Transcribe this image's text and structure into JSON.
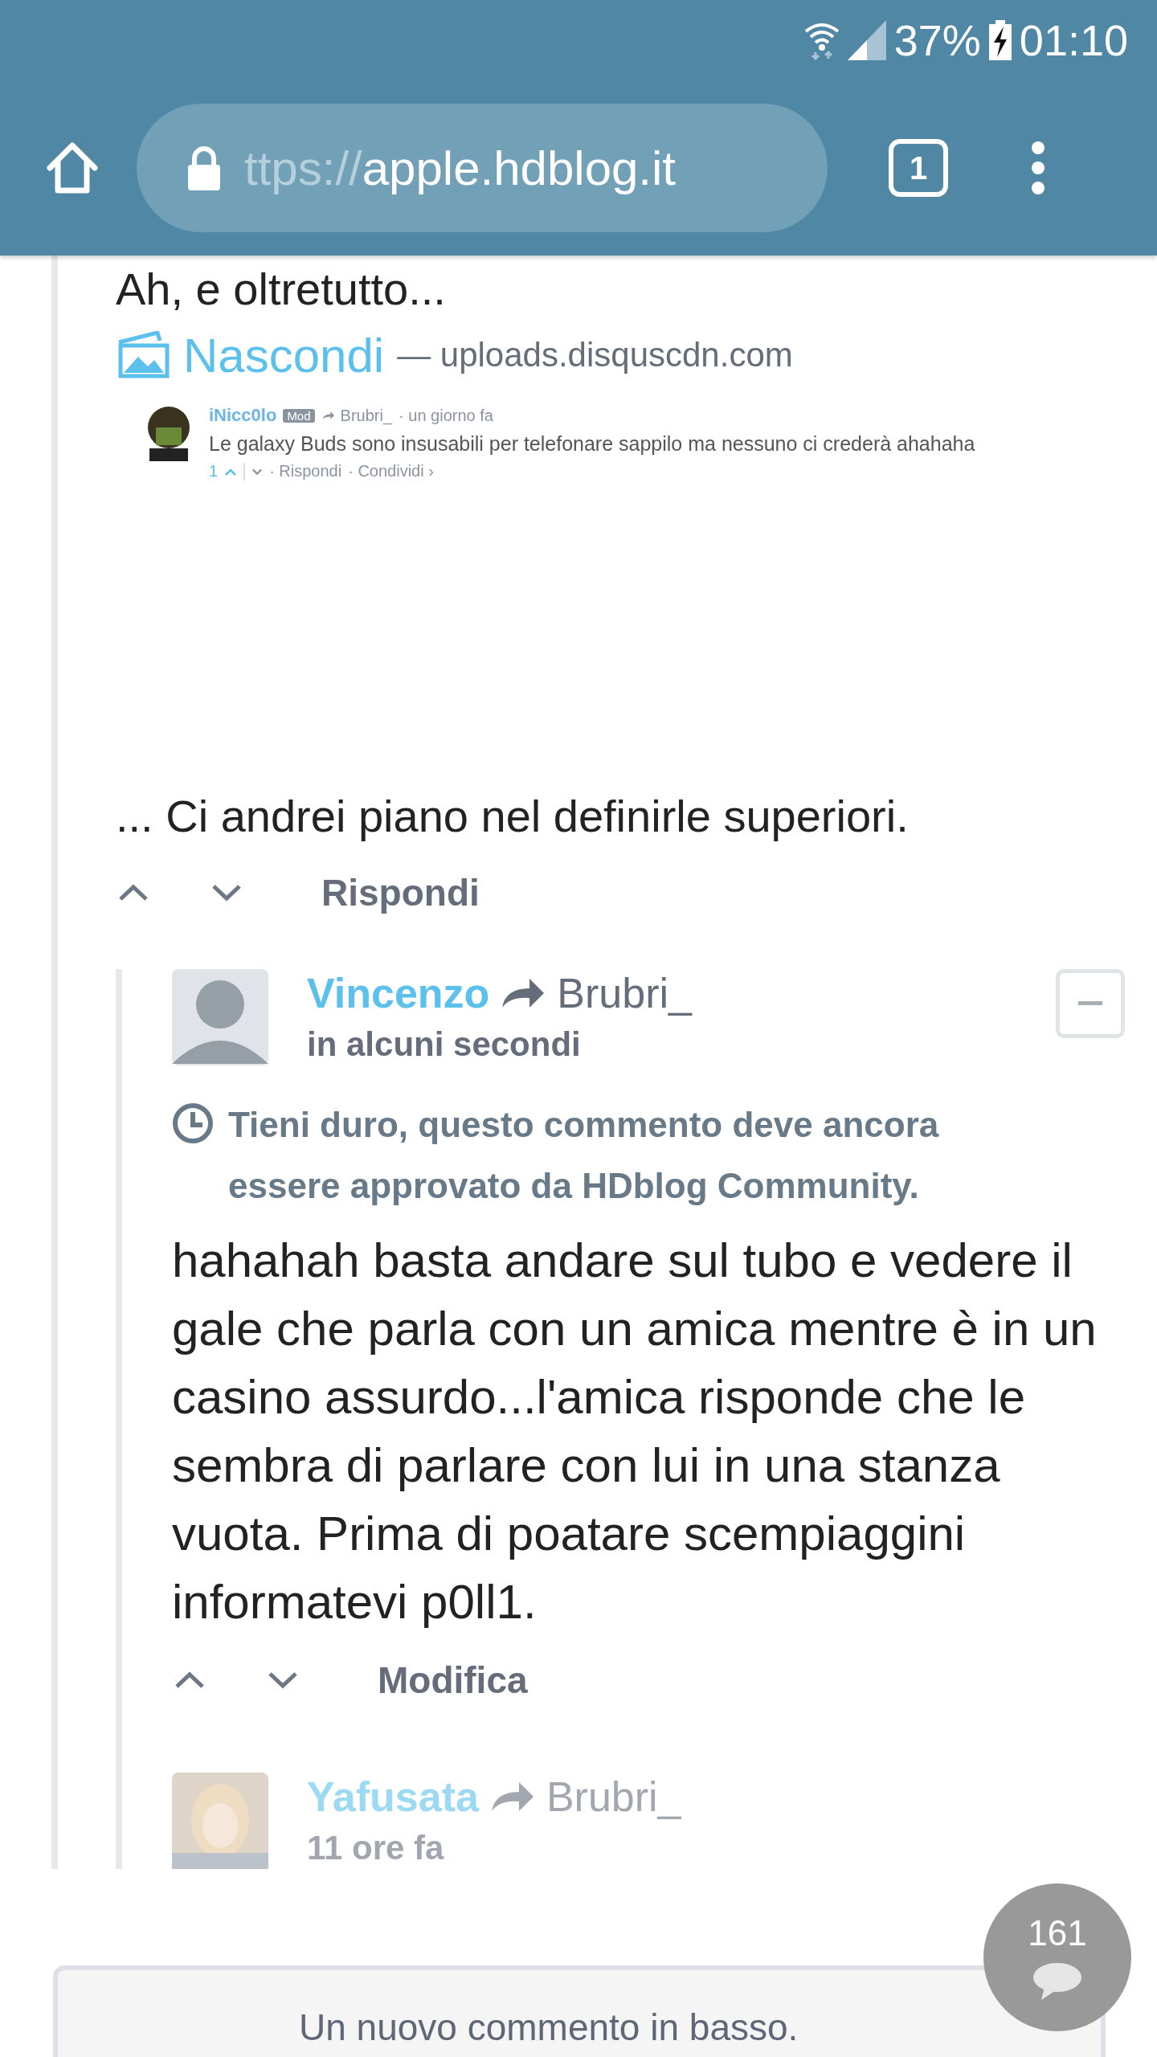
{
  "status_bar": {
    "battery": "37%",
    "time": "01:10"
  },
  "browser": {
    "url_scheme": "ttps://",
    "url_host": "apple.hdblog.it",
    "tab_count": "1"
  },
  "comment": {
    "intro": "Ah, e oltretutto...",
    "attachment": {
      "hide_label": "Nascondi",
      "source": "— uploads.disquscdn.com",
      "screenshot": {
        "author": "iNicc0lo",
        "badge": "Mod",
        "reply_to": "Brubri_",
        "time": "· un giorno fa",
        "text": "Le galaxy Buds sono insusabili per telefonare sappilo ma nessuno ci crederà ahahaha",
        "votes": "1",
        "actions": [
          "· Rispondi",
          "· Condividi ›"
        ]
      }
    },
    "closing": "... Ci andrei piano nel definirle superiori.",
    "action": "Rispondi"
  },
  "reply": {
    "author": "Vincenzo",
    "reply_to": "Brubri_",
    "time": "in alcuni secondi",
    "pending": "Tieni duro, questo commento deve ancora essere approvato da HDblog Community.",
    "body": "hahahah basta andare sul tubo e vedere il gale che parla con un amica mentre è in un casino assurdo...l'amica risponde che le sembra di parlare con lui in una stanza vuota. Prima di poatare scempiaggini informatevi p0ll1.",
    "action": "Modifica"
  },
  "next_comment": {
    "author": "Yafusata",
    "reply_to": "Brubri_",
    "time": "11 ore fa"
  },
  "toast": "Un nuovo commento in basso.",
  "counter": "161"
}
